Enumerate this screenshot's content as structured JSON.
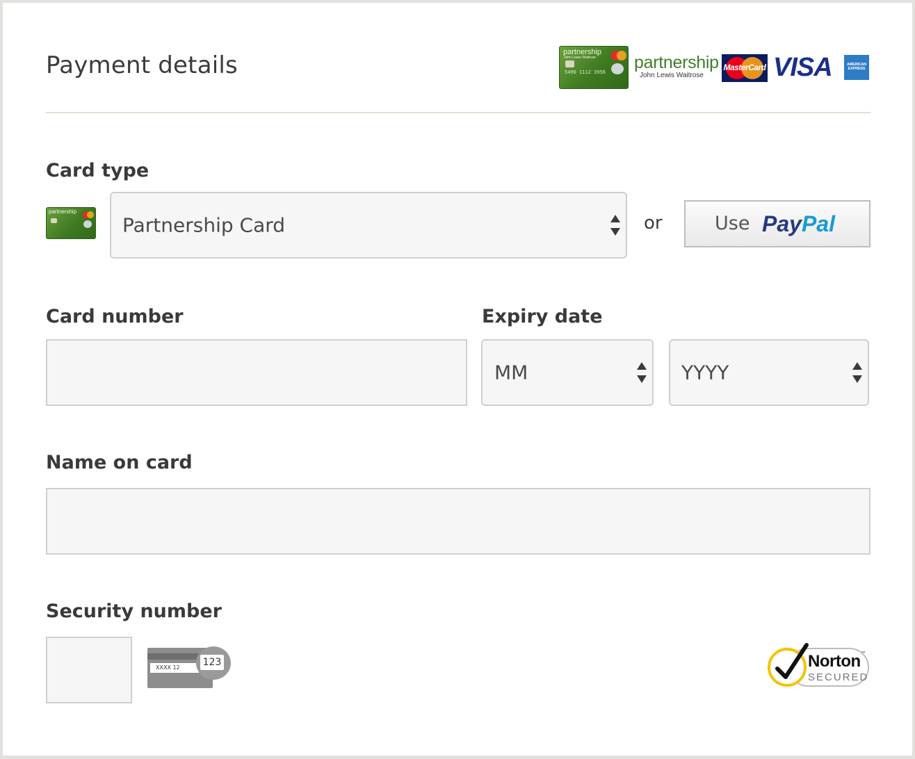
{
  "header": {
    "title": "Payment details",
    "logos": {
      "partnership_card_brand": "partnership",
      "partnership_card_sub": "John Lewis Waitrose",
      "partnership_card_number": "5490 1112 3956",
      "partnership_logo_main": "partnership",
      "partnership_logo_sub": "John Lewis Waitrose",
      "mastercard": "MasterCard",
      "visa": "VISA",
      "amex_line1": "AMERICAN",
      "amex_line2": "EXPRESS"
    }
  },
  "card_type": {
    "label": "Card type",
    "selected": "Partnership Card",
    "or_label": "or",
    "paypal_use": "Use",
    "paypal_pay": "Pay",
    "paypal_pal": "Pal"
  },
  "card_number": {
    "label": "Card number",
    "value": ""
  },
  "expiry": {
    "label": "Expiry date",
    "month_placeholder": "MM",
    "year_placeholder": "YYYY"
  },
  "name_on_card": {
    "label": "Name on card",
    "value": ""
  },
  "security": {
    "label": "Security number",
    "value": "",
    "hint_masked": "XXXX 12",
    "hint_code": "123"
  },
  "badge": {
    "brand": "Norton",
    "status": "SECURED",
    "tm": "™"
  },
  "colors": {
    "card_green": "#4f8b2b",
    "paypal_dark_blue": "#253b80",
    "paypal_light_blue": "#179bd7",
    "norton_yellow": "#f4c300",
    "divider": "#e2e0d6"
  }
}
